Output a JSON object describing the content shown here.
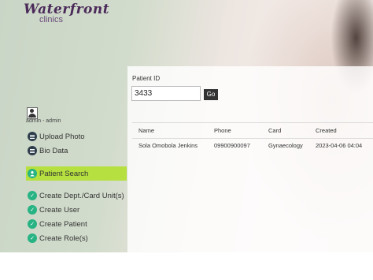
{
  "brand": {
    "name": "Waterfront",
    "sub": "clinics"
  },
  "user": {
    "label": "admin - admin"
  },
  "nav": [
    {
      "label": "Upload Photo",
      "icon": "list-icon",
      "active": false
    },
    {
      "label": "Bio Data",
      "icon": "list-icon",
      "active": false
    },
    {
      "label": "Patient Search",
      "icon": "user-search-icon",
      "active": true
    },
    {
      "label": "Create Dept./Card Unit(s)",
      "icon": "check-circle-icon",
      "active": false
    },
    {
      "label": "Create User",
      "icon": "check-circle-icon",
      "active": false
    },
    {
      "label": "Create Patient",
      "icon": "check-circle-icon",
      "active": false
    },
    {
      "label": "Create Role(s)",
      "icon": "check-circle-icon",
      "active": false
    }
  ],
  "search": {
    "label": "Patient ID",
    "value": "3433",
    "button": "Go"
  },
  "table": {
    "columns": [
      "Name",
      "Phone",
      "Card",
      "Created"
    ],
    "rows": [
      [
        "Sola Omobola Jenkins",
        "09900900097",
        "Gynaecology",
        "2023-04-06 04:04"
      ]
    ]
  },
  "colors": {
    "accent": "#b5e03f",
    "brand": "#4b2a5a",
    "icon_green": "#27b383",
    "icon_dark": "#2f3e4d"
  }
}
